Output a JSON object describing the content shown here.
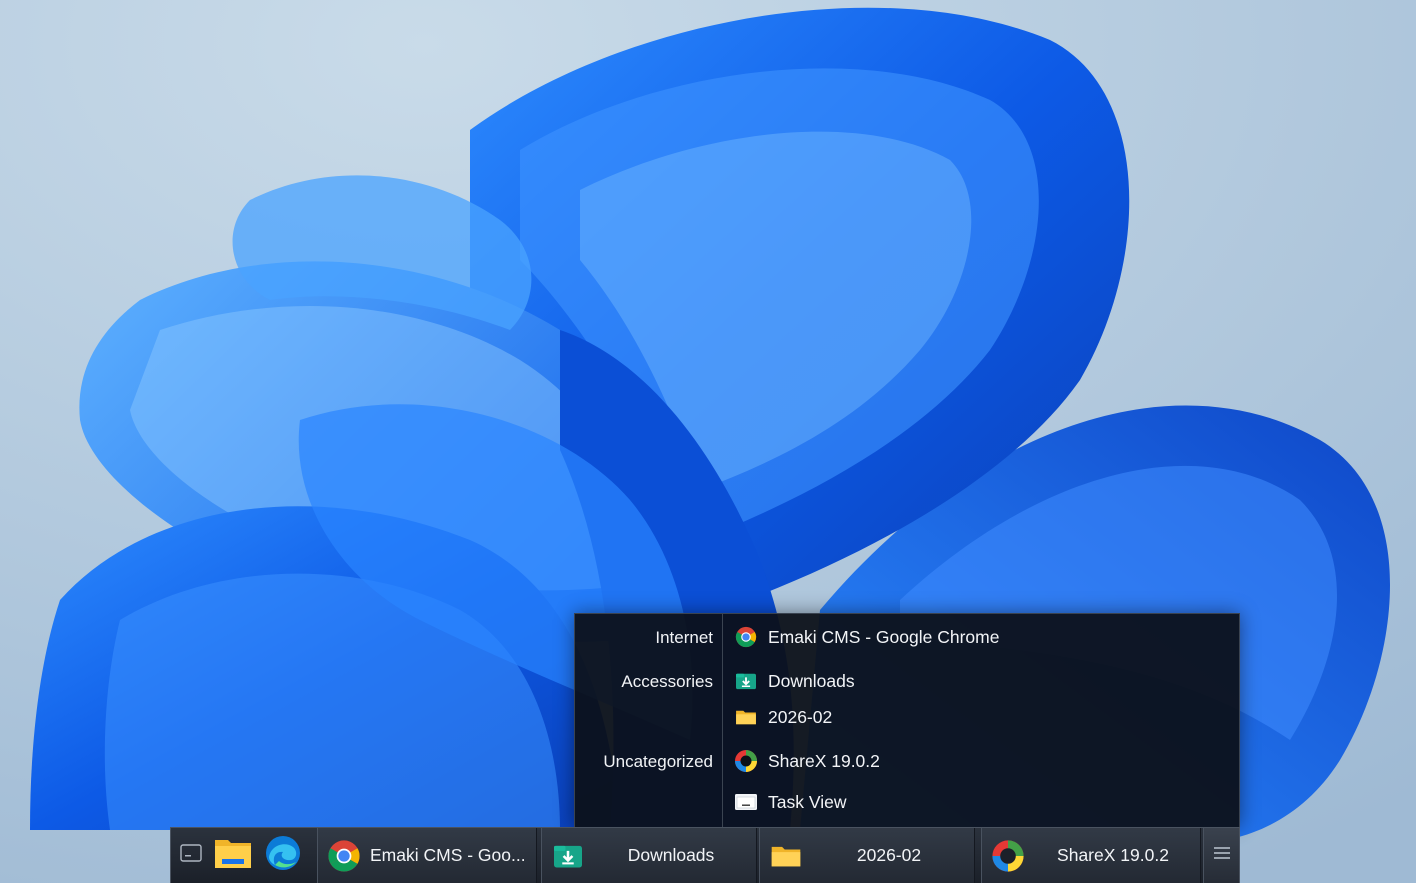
{
  "menu": {
    "categories": [
      "Internet",
      "Accessories",
      "Uncategorized"
    ],
    "items": [
      {
        "label": "Emaki CMS - Google Chrome",
        "icon": "chrome-icon"
      },
      {
        "label": "Downloads",
        "icon": "downloads-folder-icon"
      },
      {
        "label": "2026-02",
        "icon": "folder-icon"
      },
      {
        "label": "ShareX 19.0.2",
        "icon": "sharex-icon"
      },
      {
        "label": "Task View",
        "icon": "task-view-icon"
      }
    ]
  },
  "taskbar": {
    "quick_launch": [
      {
        "name": "show-desktop",
        "icon": "show-desktop-icon"
      },
      {
        "name": "file-explorer",
        "icon": "file-explorer-icon"
      },
      {
        "name": "edge",
        "icon": "edge-icon"
      }
    ],
    "tasks": [
      {
        "label": "Emaki CMS - Goo...",
        "icon": "chrome-icon"
      },
      {
        "label": "Downloads",
        "icon": "downloads-folder-icon"
      },
      {
        "label": "2026-02",
        "icon": "folder-icon"
      },
      {
        "label": "ShareX 19.0.2",
        "icon": "sharex-icon"
      }
    ],
    "menu_button_icon": "hamburger-menu-icon"
  },
  "colors": {
    "wallpaper_sky": "#b6cde0",
    "bloom_blue": "#1b6cf0",
    "menu_bg": "#0c1018",
    "taskbar_bg": "#232933",
    "text": "#f2f4f7"
  }
}
